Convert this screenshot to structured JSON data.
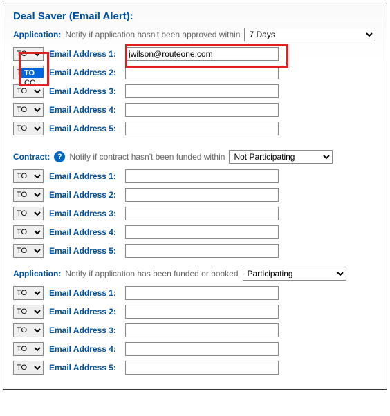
{
  "title": "Deal Saver (Email Alert):",
  "tc_default": "TO",
  "dropdown_options": {
    "to": "TO",
    "cc": "CC"
  },
  "sections": {
    "app1": {
      "label": "Application",
      "notify": "Notify if application hasn't been approved within",
      "select_value": "7 Days",
      "rows": [
        {
          "label": "Email Address 1:",
          "value": "jwilson@routeone.com"
        },
        {
          "label": "Email Address 2:",
          "value": ""
        },
        {
          "label": "Email Address 3:",
          "value": ""
        },
        {
          "label": "Email Address 4:",
          "value": ""
        },
        {
          "label": "Email Address 5:",
          "value": ""
        }
      ]
    },
    "contract": {
      "label": "Contract",
      "help": "?",
      "notify": "Notify if contract hasn't been funded within",
      "select_value": "Not Participating",
      "rows": [
        {
          "label": "Email Address 1:",
          "value": ""
        },
        {
          "label": "Email Address 2:",
          "value": ""
        },
        {
          "label": "Email Address 3:",
          "value": ""
        },
        {
          "label": "Email Address 4:",
          "value": ""
        },
        {
          "label": "Email Address 5:",
          "value": ""
        }
      ]
    },
    "app2": {
      "label": "Application",
      "notify": "Notify if application has been funded or booked",
      "select_value": "Participating",
      "rows": [
        {
          "label": "Email Address 1:",
          "value": ""
        },
        {
          "label": "Email Address 2:",
          "value": ""
        },
        {
          "label": "Email Address 3:",
          "value": ""
        },
        {
          "label": "Email Address 4:",
          "value": ""
        },
        {
          "label": "Email Address 5:",
          "value": ""
        }
      ]
    }
  }
}
